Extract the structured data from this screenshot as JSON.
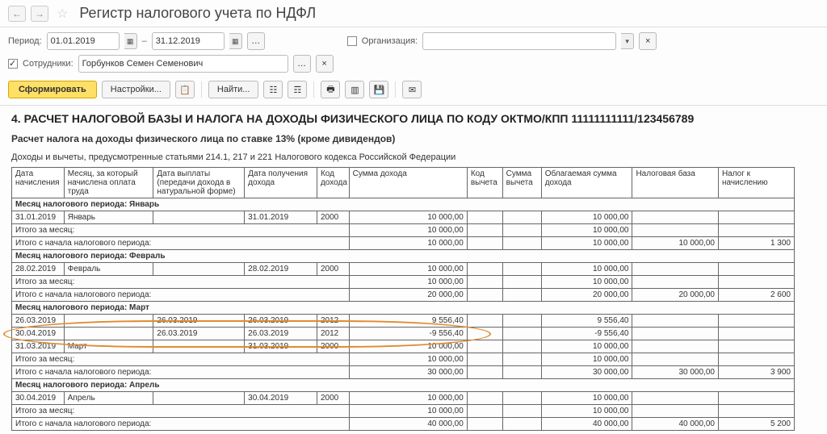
{
  "title": "Регистр налогового учета по НДФЛ",
  "filters": {
    "period_label": "Период:",
    "date_from": "01.01.2019",
    "date_to": "31.12.2019",
    "org_label": "Организация:",
    "org_value": "",
    "emp_label": "Сотрудники:",
    "emp_value": "Горбунков Семен Семенович"
  },
  "toolbar": {
    "form": "Сформировать",
    "settings": "Настройки...",
    "find": "Найти..."
  },
  "report": {
    "title": "4. РАСЧЕТ НАЛОГОВОЙ БАЗЫ И НАЛОГА НА ДОХОДЫ ФИЗИЧЕСКОГО ЛИЦА ПО КОДУ ОКТМО/КПП 11111111111/123456789",
    "subtitle": "Расчет налога на доходы физического лица по ставке 13% (кроме дивидендов)",
    "note": "Доходы и вычеты, предусмотренные статьями 214.1, 217 и 221 Налогового кодекса Российской Федерации",
    "headers": [
      "Дата начисления",
      "Месяц, за который начислена оплата труда",
      "Дата выплаты (передачи дохода в натуральной форме)",
      "Дата получения дохода",
      "Код дохода",
      "Сумма дохода",
      "Код вычета",
      "Сумма вычета",
      "Облагаемая сумма дохода",
      "Налоговая база",
      "Налог к начислению"
    ],
    "months": [
      {
        "group": "Месяц налогового периода: Январь",
        "rows": [
          {
            "d": "31.01.2019",
            "m": "Январь",
            "pay": "",
            "recv": "31.01.2019",
            "code": "2000",
            "sum": "10 000,00",
            "vc": "",
            "vs": "",
            "tax": "10 000,00",
            "base": "",
            "acc": ""
          }
        ],
        "itog_month": {
          "sum": "10 000,00",
          "tax": "10 000,00",
          "base": "",
          "acc": ""
        },
        "itog_cum": {
          "sum": "10 000,00",
          "tax": "10 000,00",
          "base": "10 000,00",
          "acc": "1 300"
        }
      },
      {
        "group": "Месяц налогового периода: Февраль",
        "rows": [
          {
            "d": "28.02.2019",
            "m": "Февраль",
            "pay": "",
            "recv": "28.02.2019",
            "code": "2000",
            "sum": "10 000,00",
            "vc": "",
            "vs": "",
            "tax": "10 000,00",
            "base": "",
            "acc": ""
          }
        ],
        "itog_month": {
          "sum": "10 000,00",
          "tax": "10 000,00",
          "base": "",
          "acc": ""
        },
        "itog_cum": {
          "sum": "20 000,00",
          "tax": "20 000,00",
          "base": "20 000,00",
          "acc": "2 600"
        }
      },
      {
        "group": "Месяц налогового периода: Март",
        "rows": [
          {
            "d": "26.03.2019",
            "m": "",
            "pay": "26.03.2019",
            "recv": "26.03.2019",
            "code": "2012",
            "sum": "9 556,40",
            "vc": "",
            "vs": "",
            "tax": "9 556,40",
            "base": "",
            "acc": ""
          },
          {
            "d": "30.04.2019",
            "m": "",
            "pay": "26.03.2019",
            "recv": "26.03.2019",
            "code": "2012",
            "sum": "-9 556,40",
            "vc": "",
            "vs": "",
            "tax": "-9 556,40",
            "base": "",
            "acc": ""
          },
          {
            "d": "31.03.2019",
            "m": "Март",
            "pay": "",
            "recv": "31.03.2019",
            "code": "2000",
            "sum": "10 000,00",
            "vc": "",
            "vs": "",
            "tax": "10 000,00",
            "base": "",
            "acc": ""
          }
        ],
        "itog_month": {
          "sum": "10 000,00",
          "tax": "10 000,00",
          "base": "",
          "acc": ""
        },
        "itog_cum": {
          "sum": "30 000,00",
          "tax": "30 000,00",
          "base": "30 000,00",
          "acc": "3 900"
        }
      },
      {
        "group": "Месяц налогового периода: Апрель",
        "rows": [
          {
            "d": "30.04.2019",
            "m": "Апрель",
            "pay": "",
            "recv": "30.04.2019",
            "code": "2000",
            "sum": "10 000,00",
            "vc": "",
            "vs": "",
            "tax": "10 000,00",
            "base": "",
            "acc": ""
          }
        ],
        "itog_month": {
          "sum": "10 000,00",
          "tax": "10 000,00",
          "base": "",
          "acc": ""
        },
        "itog_cum": {
          "sum": "40 000,00",
          "tax": "40 000,00",
          "base": "40 000,00",
          "acc": "5 200"
        }
      }
    ],
    "labels": {
      "itog_month": "Итого за месяц:",
      "itog_cum": "Итого с начала налогового периода:"
    }
  }
}
